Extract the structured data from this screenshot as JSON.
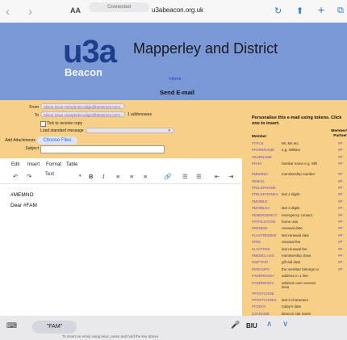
{
  "browser": {
    "text_size": "AA",
    "status": "Connected",
    "url": "u3abeacon.org.uk",
    "back_icon": "chevron-left-icon",
    "forward_icon": "chevron-right-icon"
  },
  "header": {
    "logo_main": "u3a",
    "logo_sub": "Beacon",
    "site_title": "Mapperley and District",
    "home_link": "Home",
    "page_heading": "Send E-mail"
  },
  "form": {
    "from_label": "From",
    "from_value": "Alison Gove-Humphries<alig4@btinternet.com>",
    "to_label": "To",
    "to_value": "Alison Gove-Humphries<alig4@btinternet.com>",
    "addressee_count": "1 addressees",
    "copy_checkbox_label": "Tick to receive copy",
    "load_message_label": "Load standard message",
    "attachments_label": "Add Attachments",
    "choose_files_label": "Choose Files",
    "subject_label": "Subject"
  },
  "editor": {
    "menus": [
      "Edit",
      "Insert",
      "Format",
      "Table"
    ],
    "style_select": "Text",
    "body_lines": [
      "#MEMNO",
      "Dear #FAM"
    ]
  },
  "tokens": {
    "intro": "Personalise this e-mail using tokens. Click one to insert.",
    "col_member": "Member",
    "col_partner": "Member/ Partner",
    "rows": [
      {
        "token": "#TITLE",
        "desc": "Mr, Ms etc.",
        "mark": "#P"
      },
      {
        "token": "#FORENAME",
        "desc": "e.g. William",
        "mark": "#P"
      },
      {
        "token": "#SURNAME",
        "desc": "",
        "mark": "#P"
      },
      {
        "token": "#FAM",
        "desc": "familiar name e.g. Will",
        "mark": "#P"
      },
      {
        "token": "#MEMNO",
        "desc": "membership number",
        "mark": "#P"
      },
      {
        "token": "#EMAIL",
        "desc": "",
        "mark": "#P"
      },
      {
        "token": "#TELEPHONE",
        "desc": "",
        "mark": "#P"
      },
      {
        "token": "#TELEPHONE4",
        "desc": "last 4 digits",
        "mark": "#P"
      },
      {
        "token": "#MOBILE",
        "desc": "",
        "mark": "#P"
      },
      {
        "token": "#MOBILE4",
        "desc": "last 4 digits",
        "mark": "#P"
      },
      {
        "token": "#EMERGENCY",
        "desc": "emergency contact",
        "mark": "#P"
      },
      {
        "token": "#AFFILIATION",
        "desc": "home u3a",
        "mark": "#P"
      },
      {
        "token": "#RENEW",
        "desc": "renewal date",
        "mark": "#P"
      },
      {
        "token": "#LASTRENEW",
        "desc": "last renewal date",
        "mark": "#P"
      },
      {
        "token": "#FEE",
        "desc": "renewal fee",
        "mark": "#P"
      },
      {
        "token": "#LASTFEE",
        "desc": "last renewal fee",
        "mark": "#P"
      },
      {
        "token": "#MEMCLASS",
        "desc": "membership class",
        "mark": "#P"
      },
      {
        "token": "#GIFTAID",
        "desc": "gift aid date",
        "mark": "#P"
      },
      {
        "token": "#GROUPS",
        "desc": "the member belongs to",
        "mark": "#P"
      },
      {
        "token": "#ADDRESSH",
        "desc": "address in 1 line",
        "mark": ""
      },
      {
        "token": "#ADDRESSV",
        "desc": "address over several lines",
        "mark": ""
      },
      {
        "token": "#POSTCODE",
        "desc": "",
        "mark": ""
      },
      {
        "token": "#POSTCODES",
        "desc": "last 3 characters",
        "mark": ""
      },
      {
        "token": "#TODAY",
        "desc": "today's date",
        "mark": ""
      },
      {
        "token": "U3ANAME",
        "desc": "Beacon site name",
        "mark": ""
      }
    ]
  },
  "keyboard": {
    "suggestion": "\"FAM\"",
    "format_label": "BIU",
    "hint": "To insert an emoji using keys, press and hold the key above."
  }
}
